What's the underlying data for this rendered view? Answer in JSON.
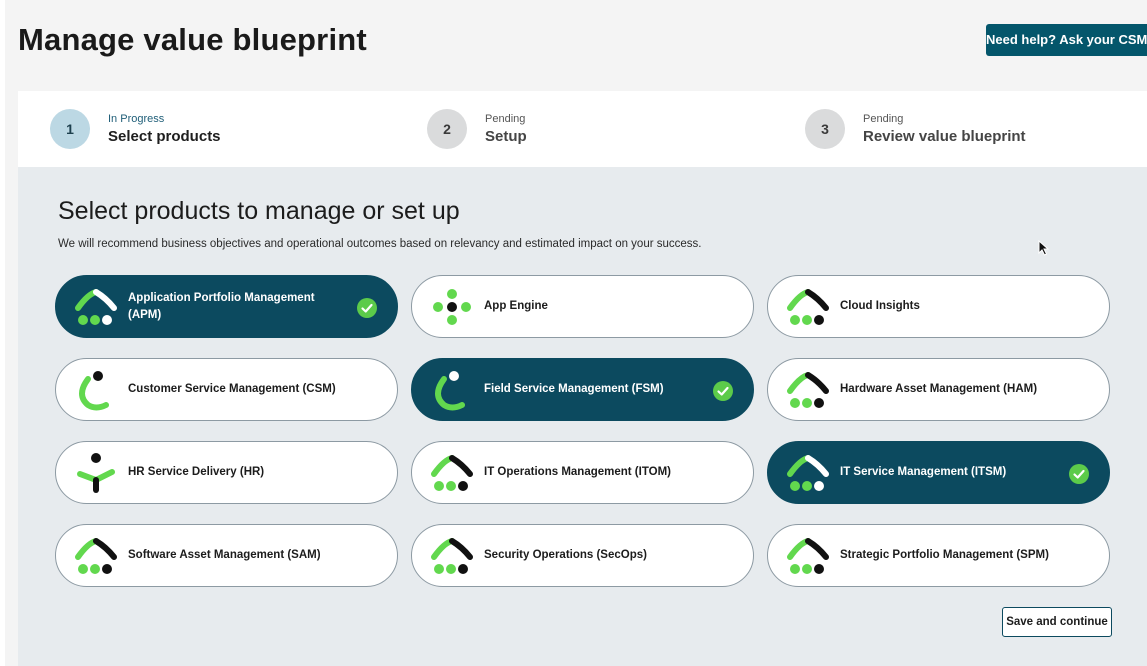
{
  "page": {
    "title": "Manage value blueprint",
    "help_button": "Need help? Ask your CSM"
  },
  "stepper": {
    "steps": [
      {
        "number": "1",
        "status": "In Progress",
        "label": "Select products"
      },
      {
        "number": "2",
        "status": "Pending",
        "label": "Setup"
      },
      {
        "number": "3",
        "status": "Pending",
        "label": "Review value blueprint"
      }
    ]
  },
  "section": {
    "title": "Select products to manage or set up",
    "description": "We will recommend business objectives and operational outcomes based on relevancy and estimated impact on your success."
  },
  "products": [
    {
      "name": "Application Portfolio Management (APM)",
      "selected": true,
      "icon": "peak-dots-icon"
    },
    {
      "name": "App Engine",
      "selected": false,
      "icon": "cross-dots-icon"
    },
    {
      "name": "Cloud Insights",
      "selected": false,
      "icon": "peak-dots-icon"
    },
    {
      "name": "Customer Service Management (CSM)",
      "selected": false,
      "icon": "arc-dot-icon"
    },
    {
      "name": "Field Service Management (FSM)",
      "selected": true,
      "icon": "arc-dot-icon"
    },
    {
      "name": "Hardware Asset Management (HAM)",
      "selected": false,
      "icon": "peak-dots-icon"
    },
    {
      "name": "HR Service Delivery (HR)",
      "selected": false,
      "icon": "person-arrow-icon"
    },
    {
      "name": "IT Operations Management (ITOM)",
      "selected": false,
      "icon": "peak-dots-icon"
    },
    {
      "name": "IT Service Management (ITSM)",
      "selected": true,
      "icon": "peak-dots-icon"
    },
    {
      "name": "Software Asset Management (SAM)",
      "selected": false,
      "icon": "peak-dots-icon"
    },
    {
      "name": "Security Operations (SecOps)",
      "selected": false,
      "icon": "peak-dots-icon"
    },
    {
      "name": "Strategic Portfolio Management (SPM)",
      "selected": false,
      "icon": "peak-dots-icon"
    }
  ],
  "actions": {
    "save_continue": "Save and continue"
  },
  "colors": {
    "brand_dark": "#0c4a5f",
    "help_button": "#04566b",
    "logo_green": "#62d84e",
    "check_green": "#5ccb4a",
    "content_bg": "#e7ebee"
  }
}
